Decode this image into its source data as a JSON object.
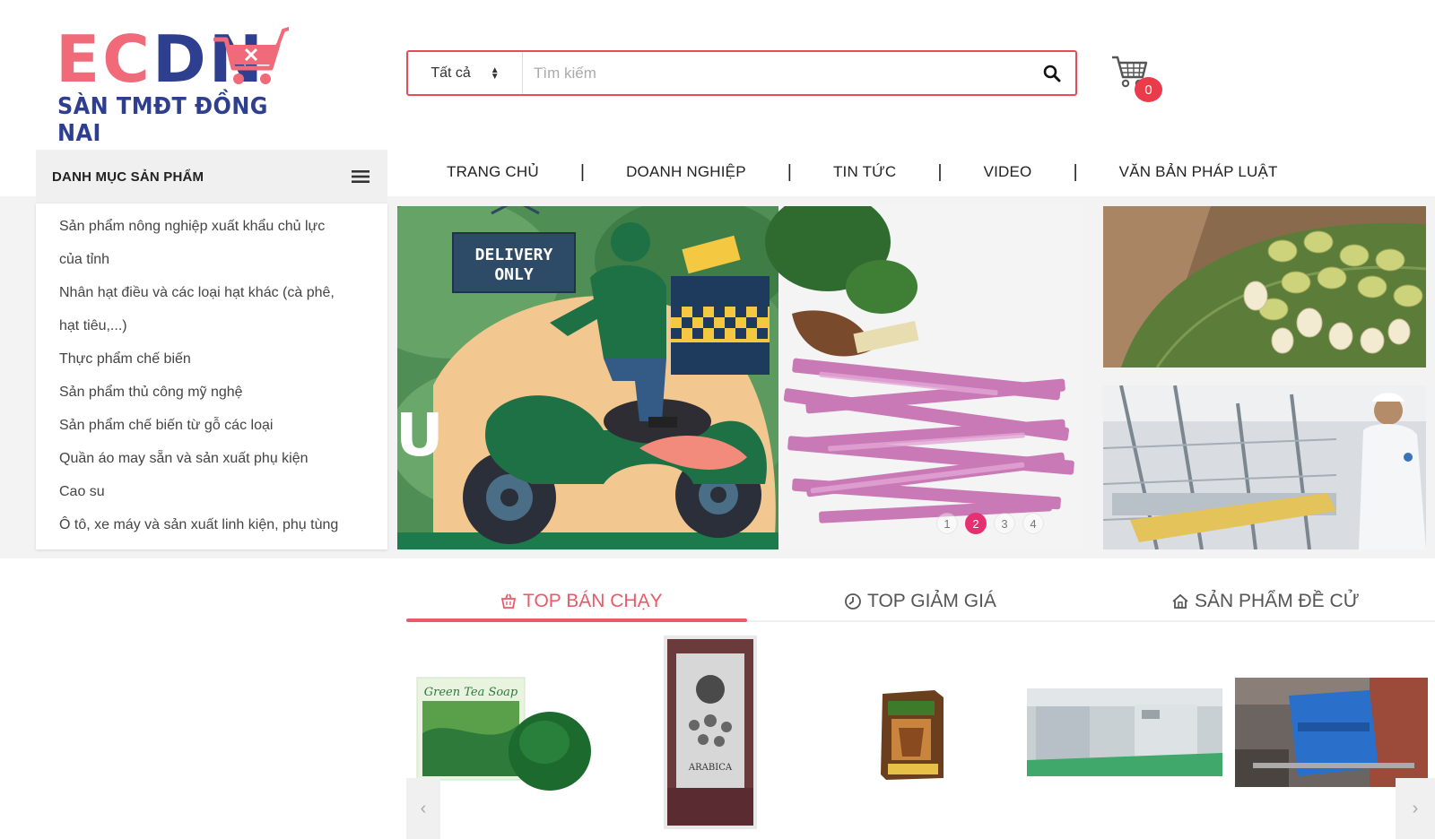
{
  "logo": {
    "ec": "EC",
    "dn": "DN",
    "subtitle": "SÀN TMĐT ĐỒNG NAI"
  },
  "search": {
    "category": "Tất cả",
    "placeholder": "Tìm kiếm",
    "value": ""
  },
  "cart": {
    "count": "0"
  },
  "category_menu": {
    "title": "DANH MỤC SẢN PHẨM",
    "items": [
      {
        "label": "Sản phẩm nông nghiệp xuất khẩu chủ lực",
        "label2": "của tỉnh"
      },
      {
        "label": "Nhân hạt điều và các loại hạt khác (cà phê,",
        "label2": "hạt tiêu,...)"
      },
      {
        "label": "Thực phẩm chế biến"
      },
      {
        "label": "Sản phẩm thủ công mỹ nghệ"
      },
      {
        "label": "Sản phẩm chế biến từ gỗ các loại"
      },
      {
        "label": "Quần áo may sẵn và sản xuất phụ kiện"
      },
      {
        "label": "Cao su"
      },
      {
        "label": "Ô tô, xe máy và sản xuất linh kiện, phụ tùng"
      }
    ]
  },
  "nav": {
    "items": [
      "TRANG CHỦ",
      "DOANH NGHIỆP",
      "TIN TỨC",
      "VIDEO",
      "VĂN BẢN PHÁP LUẬT"
    ],
    "separator": "|"
  },
  "banner": {
    "sign_line1": "DELIVERY",
    "sign_line2": "ONLY",
    "partial_letter": "U",
    "dots": [
      "1",
      "2",
      "3",
      "4"
    ],
    "active_dot": 2
  },
  "tabs": [
    {
      "label": "TOP BÁN CHẠY",
      "icon": "basket-icon",
      "active": true
    },
    {
      "label": "TOP GIẢM GIÁ",
      "icon": "clock-icon",
      "active": false
    },
    {
      "label": "SẢN PHẨM ĐỀ CỬ",
      "icon": "house-icon",
      "active": false
    }
  ],
  "products": {
    "soap_box_text": "Green Tea Soap",
    "coffee_bag_text": "ARABICA",
    "prev_arrow": "‹",
    "next_arrow": "›"
  },
  "colors": {
    "accent": "#ea4a58",
    "brand_pink": "#f06a7a",
    "brand_navy": "#2f3f8f",
    "dot_active": "#e6306f"
  }
}
